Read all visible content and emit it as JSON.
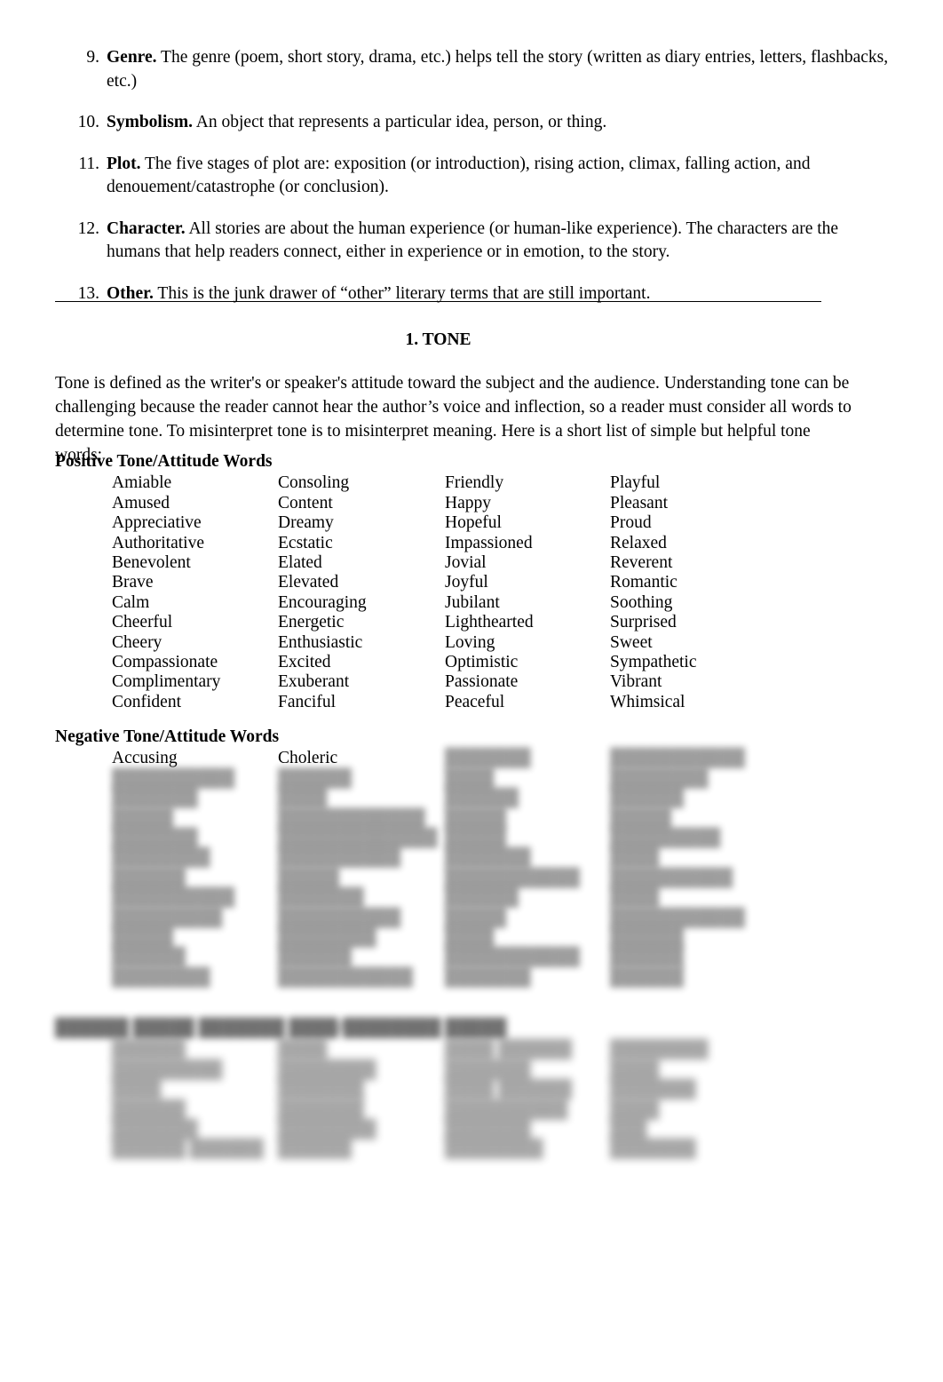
{
  "document": {
    "numbered_terms": [
      {
        "number": "9.",
        "term": "Genre.",
        "text": " The genre (poem, short story, drama, etc.) helps tell the story (written as diary entries, letters, flashbacks, etc.)"
      },
      {
        "number": "10.",
        "term": "Symbolism.",
        "text": " An object that represents a particular idea, person, or thing."
      },
      {
        "number": "11.",
        "term": "Plot.",
        "text": " The five stages of plot are: exposition (or introduction), rising action, climax, falling action, and denouement/catastrophe (or conclusion)."
      },
      {
        "number": "12.",
        "term": "Character.",
        "text": " All stories are about the human experience (or human-like experience). The characters are the humans that help readers connect, either in experience or in emotion, to the story."
      },
      {
        "number": "13.",
        "term": "Other.",
        "text": " This is the junk drawer of “other” literary terms that are still important."
      }
    ],
    "section_title": "1. TONE",
    "intro_paragraph": "Tone is defined as the writer's or speaker's attitude toward the subject and the audience. Understanding tone can be challenging because the reader cannot hear the author’s voice and inflection, so a reader must consider all words to determine tone. To misinterpret tone is to misinterpret meaning. Here is a short list of simple but helpful tone words:",
    "word_groups": [
      {
        "id": "positive",
        "heading": "Positive Tone/Attitude Words",
        "heading_blurred": false,
        "columns": [
          {
            "words": [
              "Amiable",
              "Amused",
              "Appreciative",
              "Authoritative",
              "Benevolent",
              "Brave",
              "Calm",
              "Cheerful",
              "Cheery",
              "Compassionate",
              "Complimentary",
              "Confident"
            ],
            "blurred_from_index": null
          },
          {
            "words": [
              "Consoling",
              "Content",
              "Dreamy",
              "Ecstatic",
              "Elated",
              "Elevated",
              "Encouraging",
              "Energetic",
              "Enthusiastic",
              "Excited",
              "Exuberant",
              "Fanciful"
            ],
            "blurred_from_index": null
          },
          {
            "words": [
              "Friendly",
              "Happy",
              "Hopeful",
              "Impassioned",
              "Jovial",
              "Joyful",
              "Jubilant",
              "Lighthearted",
              "Loving",
              "Optimistic",
              "Passionate",
              "Peaceful"
            ],
            "blurred_from_index": null
          },
          {
            "words": [
              "Playful",
              "Pleasant",
              "Proud",
              "Relaxed",
              "Reverent",
              "Romantic",
              "Soothing",
              "Surprised",
              "Sweet",
              "Sympathetic",
              "Vibrant",
              "Whimsical"
            ],
            "blurred_from_index": null
          }
        ]
      },
      {
        "id": "negative",
        "heading": "Negative Tone/Attitude Words",
        "heading_blurred": false,
        "columns": [
          {
            "words": [
              "Accusing",
              "██████████",
              "███████",
              "█████",
              "███████",
              "████████",
              "██████",
              "██████████",
              "█████████",
              "█████",
              "██████",
              "████████"
            ],
            "blurred_from_index": 1
          },
          {
            "words": [
              "Choleric",
              "██████",
              "████",
              "████████████",
              "█████████████",
              "██████████",
              "█████",
              "███████",
              "██████████",
              "████████",
              "██████",
              "███████████"
            ],
            "blurred_from_index": 1
          },
          {
            "words": [
              "███████",
              "████",
              "██████",
              "█████",
              "█████",
              "███████",
              "███████████",
              "██████",
              "█████",
              "████",
              "███████████",
              "███████"
            ],
            "blurred_from_index": 0
          },
          {
            "words": [
              "███████████",
              "████████",
              "██████",
              "█████",
              "█████████",
              "████",
              "██████████",
              "████",
              "███████████",
              "██████",
              "██████",
              "██████"
            ],
            "blurred_from_index": 0
          }
        ]
      },
      {
        "id": "third",
        "heading": "██████ █████ ███████ ████/████████ █████",
        "heading_blurred": true,
        "columns": [
          {
            "words": [
              "██████",
              "█████████",
              "████",
              "██████",
              "███████",
              "██████ ██████"
            ],
            "blurred_from_index": 0
          },
          {
            "words": [
              "████",
              "████████",
              "███████",
              "███████",
              "████████",
              "██████"
            ],
            "blurred_from_index": 0
          },
          {
            "words": [
              "████ ██████",
              "███████",
              "████ ██████",
              "██████████",
              "███████",
              "████████"
            ],
            "blurred_from_index": 0
          },
          {
            "words": [
              "████████",
              "████",
              "███████",
              "████",
              "███",
              "███████"
            ],
            "blurred_from_index": 0
          }
        ]
      }
    ]
  }
}
